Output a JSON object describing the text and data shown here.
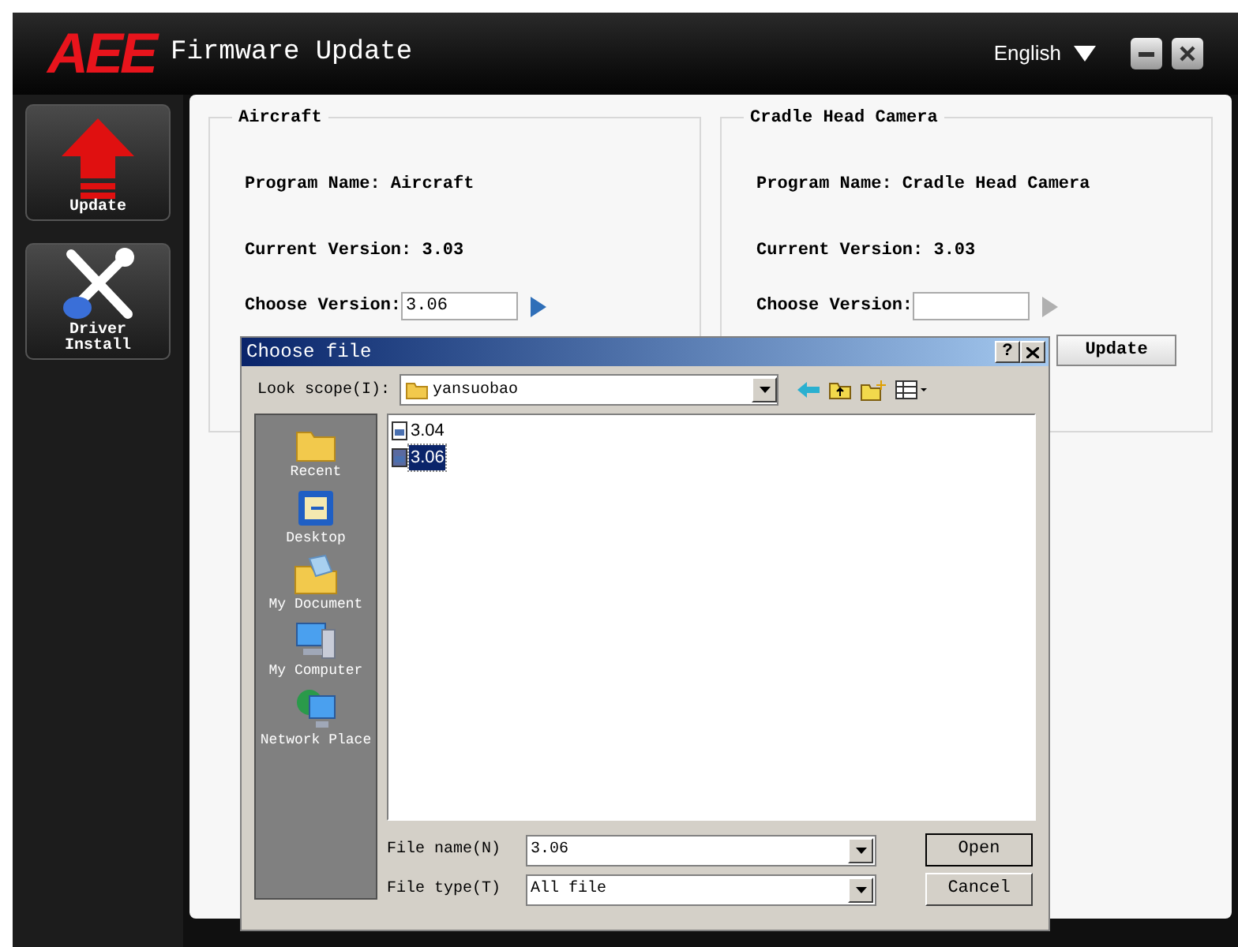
{
  "app": {
    "logo": "AEE",
    "title": "Firmware Update",
    "language": "English"
  },
  "sidebar": [
    {
      "label": "Update",
      "kind": "update"
    },
    {
      "label": "Driver Install",
      "kind": "driver"
    }
  ],
  "panels": [
    {
      "title": "Aircraft",
      "program_name": "Program Name: Aircraft",
      "current_version": "Current Version: 3.03",
      "choose_label": "Choose Version:",
      "choose_value": "3.06",
      "arrow_enabled": true
    },
    {
      "title": "Cradle Head Camera",
      "program_name": "Program Name: Cradle Head Camera",
      "current_version": "Current Version: 3.03",
      "choose_label": "Choose Version:",
      "arrow_enabled": false,
      "update_button": "Update"
    }
  ],
  "dialog": {
    "title": "Choose file",
    "help": "?",
    "look_scope_label": "Look scope(I):",
    "look_scope_value": "yansuobao",
    "places": [
      {
        "label": "Recent",
        "kind": "recent"
      },
      {
        "label": "Desktop",
        "kind": "desktop"
      },
      {
        "label": "My Document",
        "kind": "documents"
      },
      {
        "label": "My Computer",
        "kind": "computer"
      },
      {
        "label": "Network Place",
        "kind": "network"
      }
    ],
    "files": [
      {
        "name": "3.04",
        "selected": false
      },
      {
        "name": "3.06",
        "selected": true
      }
    ],
    "file_name_label": "File name(N)",
    "file_name_value": "3.06",
    "file_type_label": "File type(T)",
    "file_type_value": "All file",
    "open_button": "Open",
    "cancel_button": "Cancel"
  }
}
